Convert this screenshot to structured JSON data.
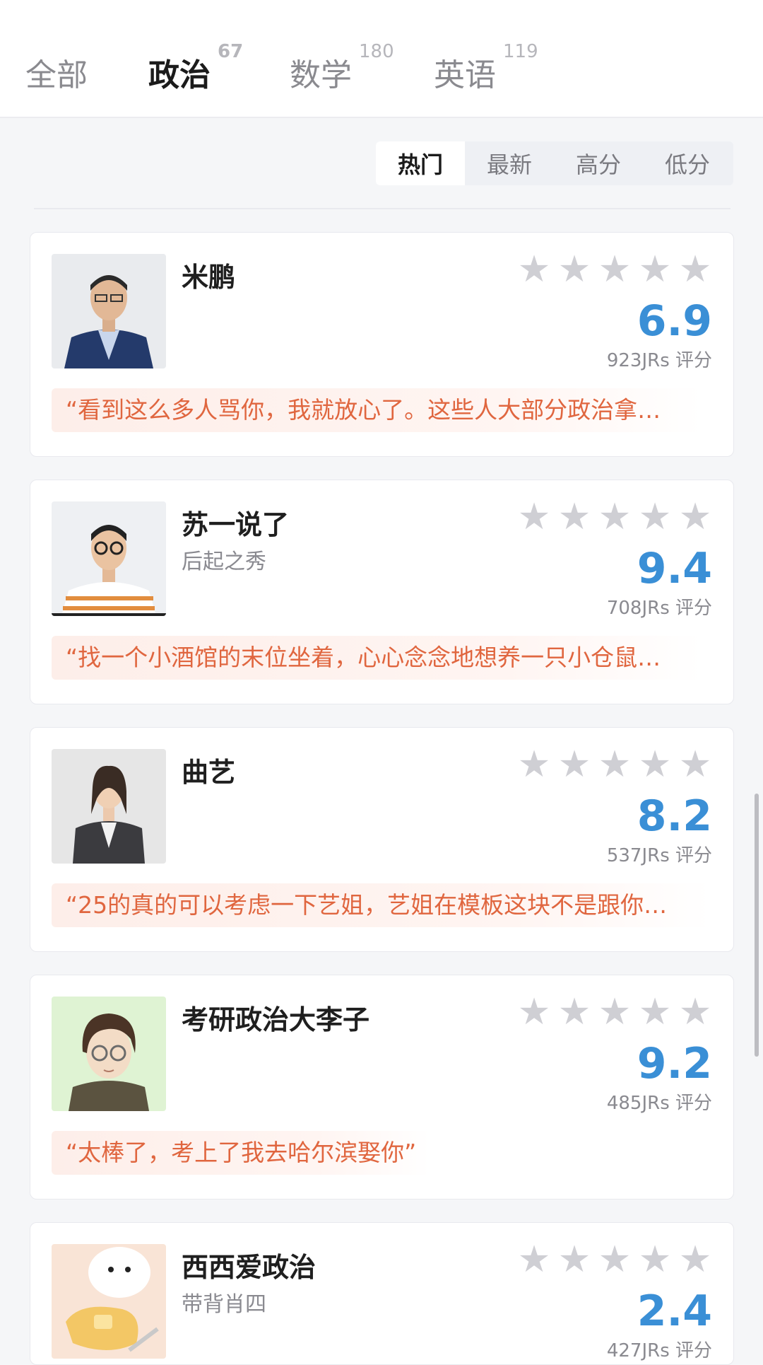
{
  "tabs": [
    {
      "label": "全部",
      "count": ""
    },
    {
      "label": "政治",
      "count": "67"
    },
    {
      "label": "数学",
      "count": "180"
    },
    {
      "label": "英语",
      "count": "119"
    }
  ],
  "sort": [
    "热门",
    "最新",
    "高分",
    "低分"
  ],
  "teachers": [
    {
      "name": "米鹏",
      "subtitle": "",
      "score": "6.9",
      "ratings": "923JRs 评分",
      "quote": "“看到这么多人骂你，我就放心了。这些人大部分政治拿…"
    },
    {
      "name": "苏一说了",
      "subtitle": "后起之秀",
      "score": "9.4",
      "ratings": "708JRs 评分",
      "quote": "“找一个小酒馆的末位坐着，心心念念地想养一只小仓鼠…"
    },
    {
      "name": "曲艺",
      "subtitle": "",
      "score": "8.2",
      "ratings": "537JRs 评分",
      "quote": "“25的真的可以考虑一下艺姐，艺姐在模板这块不是跟你…"
    },
    {
      "name": "考研政治大李子",
      "subtitle": "",
      "score": "9.2",
      "ratings": "485JRs 评分",
      "quote": "“太棒了，考上了我去哈尔滨娶你”"
    },
    {
      "name": "西西爱政治",
      "subtitle": "带背肖四",
      "score": "2.4",
      "ratings": "427JRs 评分",
      "quote": ""
    }
  ]
}
